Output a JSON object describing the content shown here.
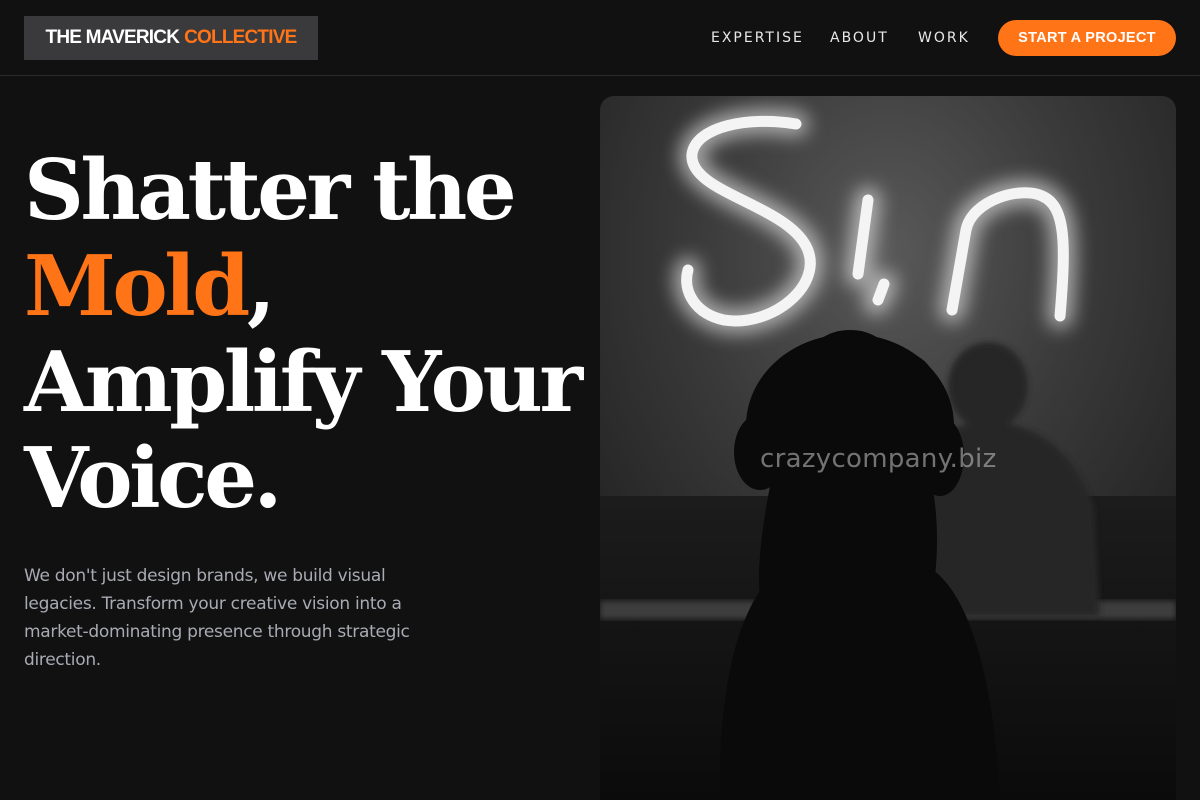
{
  "brand": {
    "name_part1": "THE MAVERICK",
    "name_part2": "COLLECTIVE"
  },
  "nav": {
    "items": [
      "EXPERTISE",
      "ABOUT",
      "WORK"
    ],
    "cta_label": "START A PROJECT"
  },
  "hero": {
    "title_line1": "Shatter the",
    "title_accent": "Mold",
    "title_comma": ",",
    "title_line3": "Amplify Your",
    "title_line4": "Voice.",
    "description": "We don't just design brands, we build visual legacies. Transform your creative vision into a market-dominating presence through strategic direction."
  },
  "image": {
    "neon_text": "Sin",
    "watermark": "crazycompany.biz"
  },
  "colors": {
    "accent": "#ff7416",
    "background": "#111112",
    "logo_bg": "#3a3a3c",
    "body_text": "#a9abb3"
  }
}
